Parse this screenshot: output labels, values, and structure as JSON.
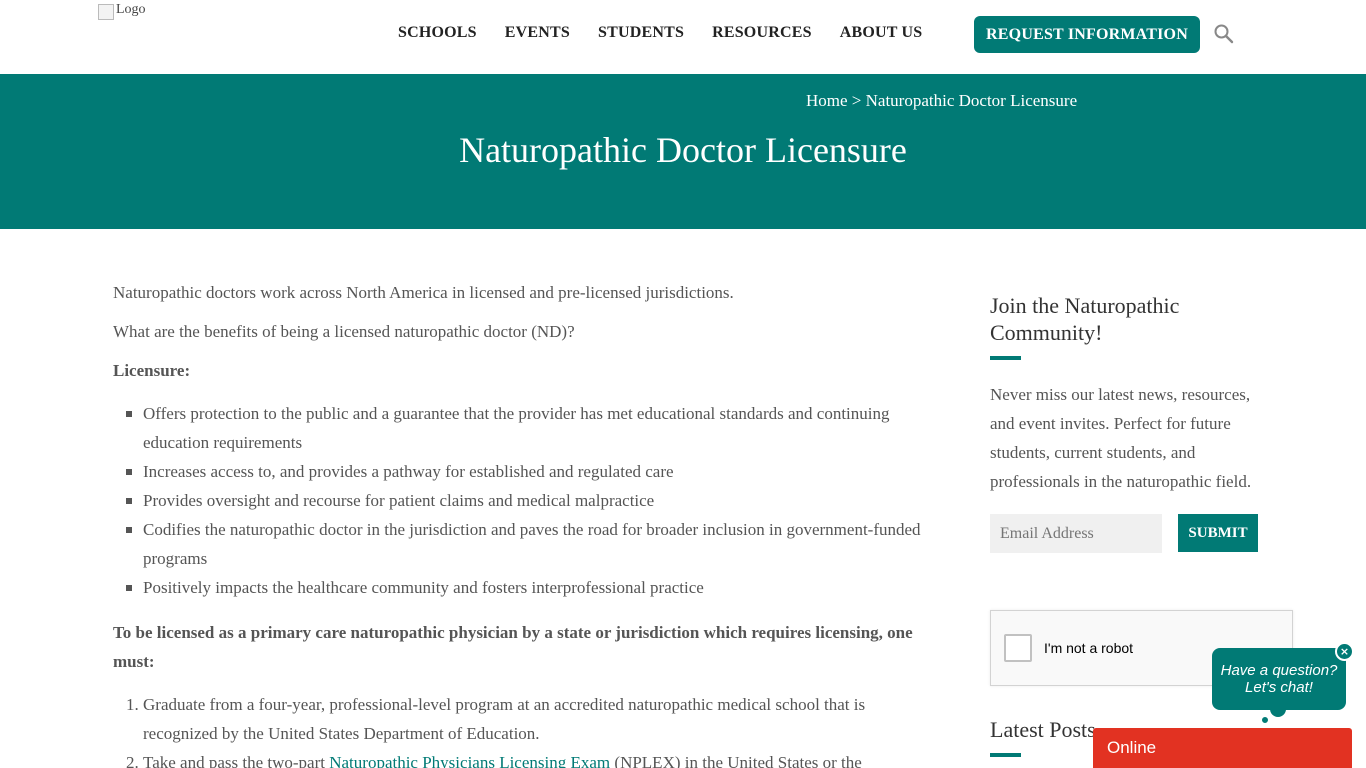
{
  "header": {
    "logo_alt": "Logo",
    "nav": [
      "SCHOOLS",
      "EVENTS",
      "STUDENTS",
      "RESOURCES",
      "ABOUT US"
    ],
    "request_button": "REQUEST INFORMATION",
    "search_icon": "search-icon"
  },
  "banner": {
    "breadcrumb_home": "Home",
    "breadcrumb_sep": " > ",
    "breadcrumb_current": "Naturopathic Doctor Licensure",
    "title": "Naturopathic Doctor Licensure"
  },
  "main": {
    "intro": "Naturopathic doctors work across North America in licensed and pre-licensed jurisdictions.",
    "question": "What are the benefits of being a licensed naturopathic doctor (ND)?",
    "licensure_heading": "Licensure:",
    "benefits": [
      "Offers protection to the public and a guarantee that the provider has met educational standards and continuing education requirements",
      "Increases access to, and provides a pathway for established and regulated care",
      "Provides oversight and recourse for patient claims and medical malpractice",
      "Codifies the naturopathic doctor in the jurisdiction and paves the road for broader inclusion in government-funded programs",
      "Positively impacts the healthcare community and fosters interprofessional practice"
    ],
    "requirements_heading": "To be licensed as a primary care naturopathic physician by a state or jurisdiction which requires licensing, one must:",
    "steps": {
      "step1": "Graduate from a four-year, professional-level program at an accredited naturopathic medical school that is recognized by the United States Department of Education.",
      "step2_prefix": "Take and pass the two-part ",
      "step2_link": "Naturopathic Physicians Licensing Exam",
      "step2_suffix": " (NPLEX) in the United States or the"
    }
  },
  "sidebar": {
    "title": "Join the Naturopathic Community!",
    "text": "Never miss our latest news, resources, and event invites. Perfect for future students, current students, and professionals in the naturopathic field.",
    "email_placeholder": "Email Address",
    "submit": "SUBMIT",
    "captcha_label": "I'm not a robot",
    "latest_posts": "Latest Posts"
  },
  "chat": {
    "line1": "Have a question?",
    "line2": "Let's chat!",
    "close": "×",
    "status": "Online"
  },
  "colors": {
    "brand": "#017a75",
    "chat_status": "#e23222"
  }
}
